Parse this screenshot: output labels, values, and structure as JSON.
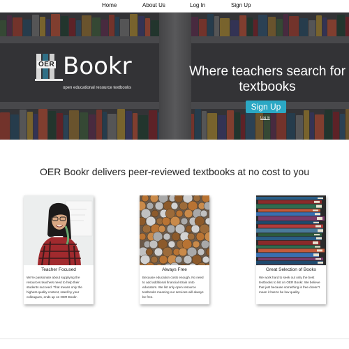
{
  "nav": {
    "home": "Home",
    "about": "About Us",
    "login": "Log In",
    "signup": "Sign Up"
  },
  "hero": {
    "logo_oer": "OER",
    "logo_word": "Bookr",
    "tagline": "open educational resource textbooks",
    "title": "Where teachers search for textbooks",
    "signup_button": "Sign Up",
    "login_link": "Log in"
  },
  "section": {
    "title": "OER Bookr delivers peer-reviewed textbooks at no cost to you"
  },
  "cards": [
    {
      "title": "Teacher Focused",
      "text": "We're passionate about supplying the resources teachers need to help their students succeed. That means only the highest-quality content, rated by your colleagues, ends up on OER Bookr.",
      "image": "teacher-photo"
    },
    {
      "title": "Always Free",
      "text": "Because education costs enough. No need to add additional financial strain onto educators. We list only open resource textbooks meaning our services will always be free.",
      "image": "coins-photo"
    },
    {
      "title": "Great Selection of Books",
      "text": "We work hard to seek out only the best textbooks to list on OER Bookr. We believe that just because something is free doesn't mean it has to be low quality.",
      "image": "book-stack-photo"
    }
  ],
  "colors": {
    "accent": "#2ba8c4",
    "hero_bg": "#3a3a3c"
  }
}
